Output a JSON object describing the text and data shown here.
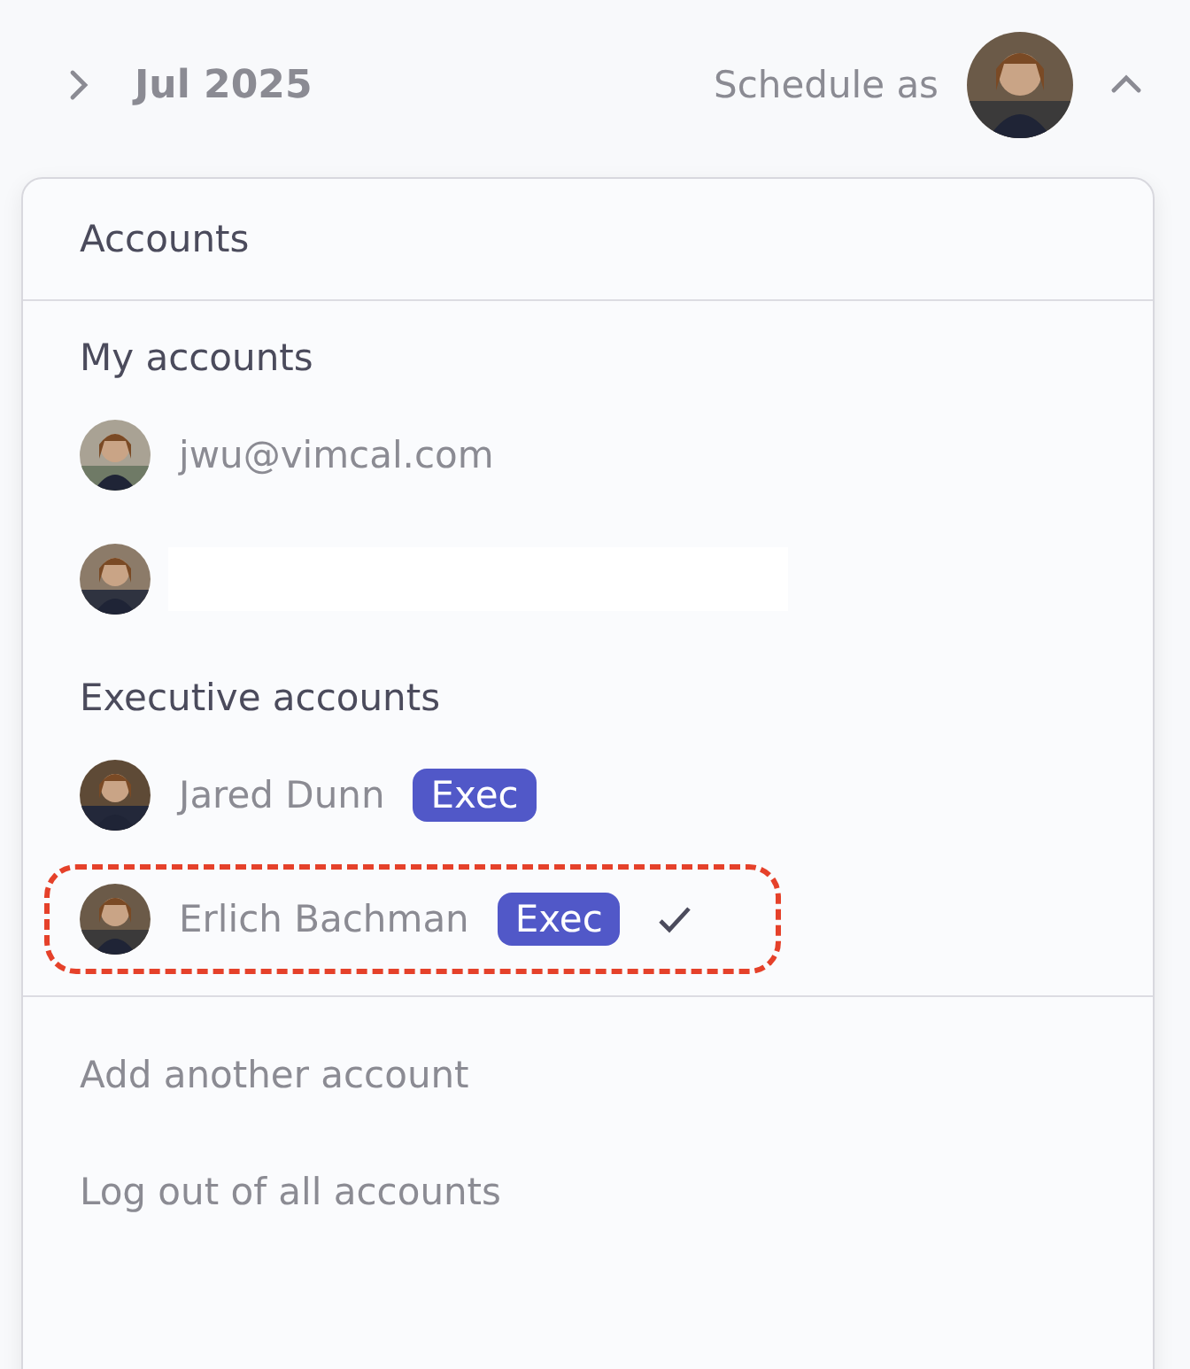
{
  "header": {
    "month": "Jul 2025",
    "schedule_label": "Schedule as",
    "expanded": true
  },
  "menu": {
    "title": "Accounts",
    "sections": [
      {
        "title": "My accounts",
        "accounts": [
          {
            "kind": "plain",
            "name": "jwu@vimcal.com",
            "selected": false
          },
          {
            "kind": "redacted",
            "selected": false
          }
        ]
      },
      {
        "title": "Executive accounts",
        "accounts": [
          {
            "kind": "plain",
            "name": "Jared Dunn",
            "badge": "Exec",
            "selected": false
          },
          {
            "kind": "plain",
            "name": "Erlich Bachman",
            "badge": "Exec",
            "selected": true
          }
        ]
      }
    ],
    "actions": [
      "Add another account",
      "Log out of all accounts"
    ]
  }
}
